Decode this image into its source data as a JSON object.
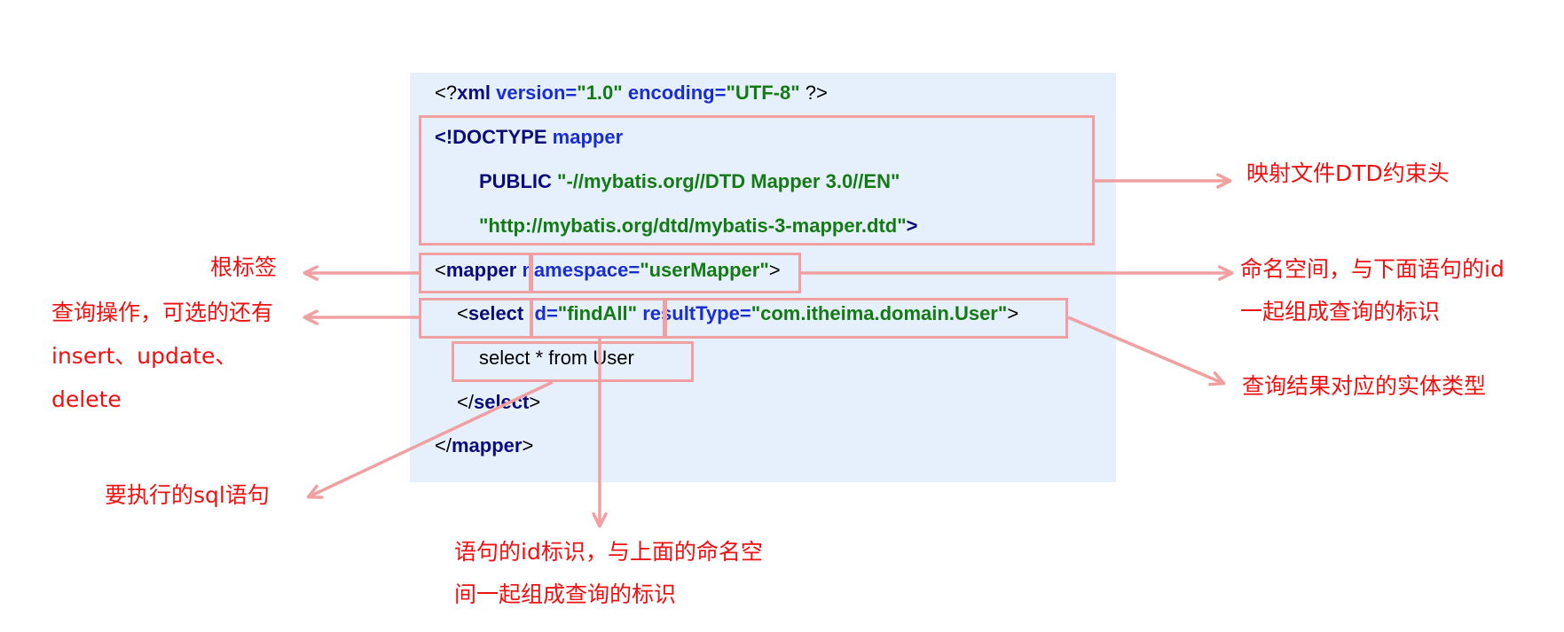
{
  "colors": {
    "panel_bg": "#e6f0fd",
    "highlight": "#f0a0a0",
    "annotation": "#ee1111",
    "tag": "#0b0b7a",
    "attribute": "#1a2ed0",
    "value": "#147a14"
  },
  "code": {
    "line1": {
      "open": "<?",
      "kw_xml": "xml",
      "attr_version": "version",
      "eq1": "=",
      "val_version": "\"1.0\"",
      "attr_encoding": "encoding",
      "eq2": "=",
      "val_encoding": "\"UTF-8\"",
      "close": "?>"
    },
    "line2": {
      "doctype": "<!DOCTYPE",
      "name": "mapper"
    },
    "line3": {
      "public": "PUBLIC",
      "id": "\"-//mybatis.org//DTD Mapper 3.0//EN\""
    },
    "line4": {
      "url": "\"http://mybatis.org/dtd/mybatis-3-mapper.dtd\"",
      "close": ">"
    },
    "line5": {
      "open": "<",
      "tag": "mapper",
      "attr": "namespace",
      "eq": "=",
      "val": "\"userMapper\"",
      "close": ">"
    },
    "line6": {
      "open": "<",
      "tag": "select",
      "attr_id": "id",
      "eq1": "=",
      "val_id": "\"findAll\"",
      "attr_rt": "resultType",
      "eq2": "=",
      "val_rt": "\"com.itheima.domain.User\"",
      "close": ">"
    },
    "line7": {
      "sql": "select * from User"
    },
    "line8": {
      "open": "</",
      "tag": "select",
      "close": ">"
    },
    "line9": {
      "open": "</",
      "tag": "mapper",
      "close": ">"
    }
  },
  "annotations": {
    "dtd_header": "映射文件DTD约束头",
    "root_tag": "根标签",
    "namespace_line1": "命名空间，与下面语句的id",
    "namespace_line2": "一起组成查询的标识",
    "operation_line1": "查询操作，可选的还有",
    "operation_line2": "insert、update、",
    "operation_line3": "delete",
    "result_type": "查询结果对应的实体类型",
    "sql_statement": "要执行的sql语句",
    "statement_id_line1": "语句的id标识，与上面的命名空",
    "statement_id_line2": "间一起组成查询的标识"
  }
}
